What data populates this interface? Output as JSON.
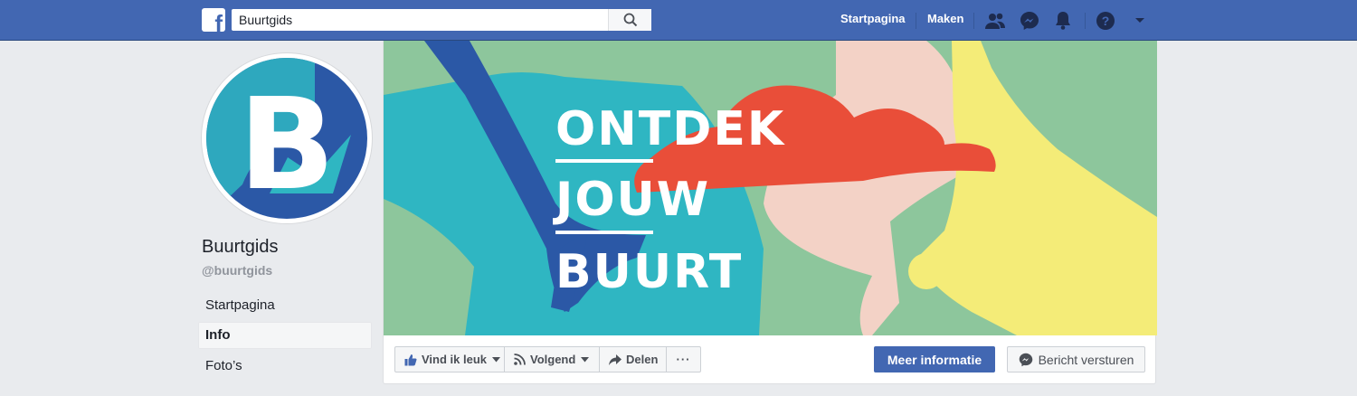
{
  "topbar": {
    "logo_letter": "f",
    "search_value": "Buurtgids",
    "nav": {
      "home": "Startpagina",
      "create": "Maken"
    },
    "icons": [
      "friends-icon",
      "messenger-icon",
      "notifications-icon",
      "help-icon",
      "account-caret-icon"
    ],
    "colors": {
      "bar": "#4267b2"
    }
  },
  "page": {
    "name": "Buurtgids",
    "handle": "@buurtgids",
    "avatar_letter": "B"
  },
  "sidebar": {
    "items": [
      {
        "label": "Startpagina",
        "active": false
      },
      {
        "label": "Info",
        "active": true
      },
      {
        "label": "Foto’s",
        "active": false
      }
    ]
  },
  "cover": {
    "lines": [
      "ONTDEK",
      "JOUW",
      "BUURT"
    ],
    "colors": {
      "green": "#8dc69c",
      "teal": "#2fb6c2",
      "blue": "#2b58a6",
      "red": "#e94e39",
      "pink": "#f3d2c6",
      "yellow": "#f4ec78"
    }
  },
  "actions": {
    "like": "Vind ik leuk",
    "follow": "Volgend",
    "share": "Delen",
    "more": "···",
    "primary": "Meer informatie",
    "message": "Bericht versturen"
  }
}
